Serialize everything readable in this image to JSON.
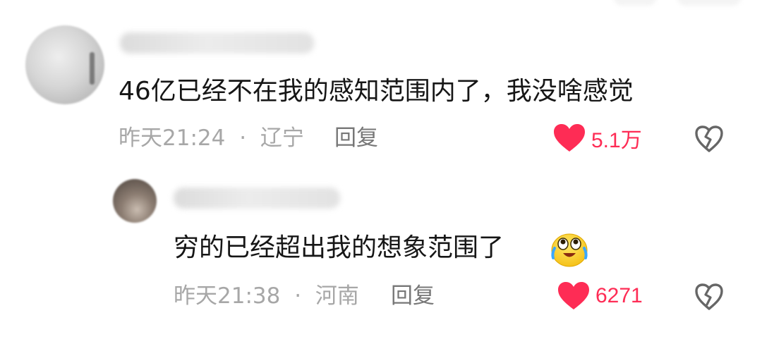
{
  "comments": [
    {
      "text": "46亿已经不在我的感知范围内了，我没啥感觉",
      "time": "昨天21:24",
      "separator": "·",
      "location": "辽宁",
      "reply_label": "回复",
      "likes": "5.1万"
    },
    {
      "text": "穷的已经超出我的想象范围了",
      "emoji": "crying-laughing-emoji",
      "time": "昨天21:38",
      "separator": "·",
      "location": "河南",
      "reply_label": "回复",
      "likes": "6271"
    }
  ],
  "colors": {
    "like_red": "#fe2c55",
    "meta_gray": "#a7a7a7",
    "text_dark": "#161616"
  },
  "icons": [
    "heart-icon",
    "broken-heart-icon",
    "crying-laughing-emoji"
  ]
}
